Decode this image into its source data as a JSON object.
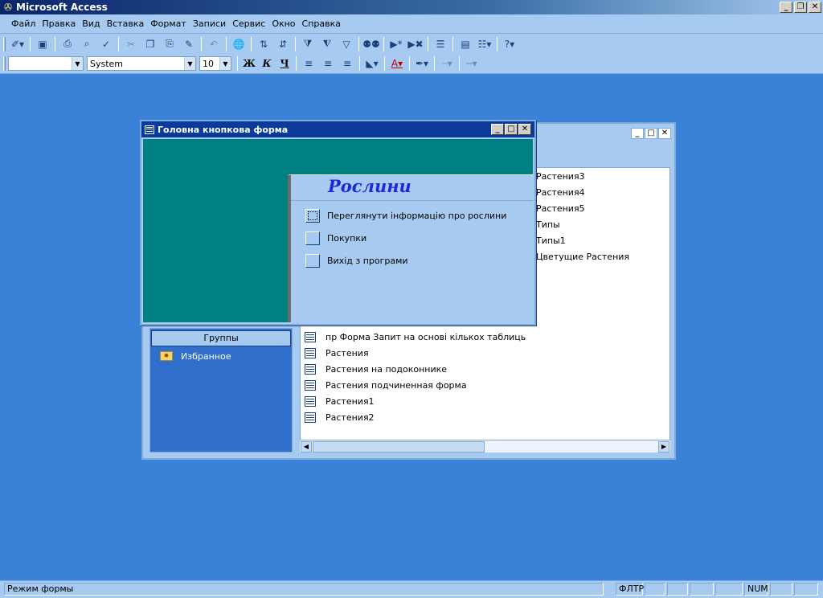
{
  "app": {
    "title": "Microsoft Access"
  },
  "menu": [
    {
      "label": "Файл"
    },
    {
      "label": "Правка"
    },
    {
      "label": "Вид"
    },
    {
      "label": "Вставка"
    },
    {
      "label": "Формат"
    },
    {
      "label": "Записи"
    },
    {
      "label": "Сервис"
    },
    {
      "label": "Окно"
    },
    {
      "label": "Справка"
    }
  ],
  "format_toolbar": {
    "object_combo": "",
    "font_combo": "System",
    "size_combo": "10",
    "bold": "Ж",
    "italic": "К",
    "underline": "Ч"
  },
  "db_window": {
    "groups_label": "Группы",
    "favorites_label": "Избранное",
    "items_upper": [
      "Растения3",
      "Растения4",
      "Растения5",
      "Типы",
      "Типы1",
      "Цветущие Растения"
    ],
    "items_lower": [
      "пр Форма Запит на основі кількох таблиць",
      "Растения",
      "Растения на подоконнике",
      "Растения подчиненная форма",
      "Растения1",
      "Растения2"
    ]
  },
  "switchboard": {
    "title": "Головна кнопкова форма",
    "heading": "Рослини",
    "items": [
      {
        "label": "Переглянути інформацію про рослини"
      },
      {
        "label": "Покупки"
      },
      {
        "label": "Вихід з програми"
      }
    ]
  },
  "status": {
    "mode": "Режим формы",
    "filter": "ФЛТР",
    "num": "NUM"
  },
  "colors": {
    "desktop": "#3a81d8",
    "chrome": "#a6caf0",
    "switchboard_bg": "#008080",
    "heading": "#1b2ad8"
  }
}
